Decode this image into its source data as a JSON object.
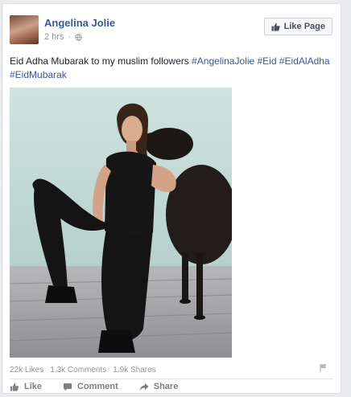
{
  "post": {
    "author": "Angelina Jolie",
    "time": "2 hrs",
    "like_page_label": "Like Page",
    "text_plain": "Eid Adha Mubarak to my muslim followers",
    "hashtags": [
      "#AngelinaJolie",
      "#Eid",
      "#EidAlAdha",
      "#EidMubarak"
    ],
    "photo_icon": "photo-of-woman-in-black-with-black-sheep"
  },
  "stats": {
    "likes": "22k Likes",
    "comments": "1.3k Comments",
    "shares": "1.9k Shares"
  },
  "actions": {
    "like": "Like",
    "comment": "Comment",
    "share": "Share"
  },
  "colors": {
    "link": "#365899",
    "muted": "#90949c",
    "text": "#1d2129"
  }
}
